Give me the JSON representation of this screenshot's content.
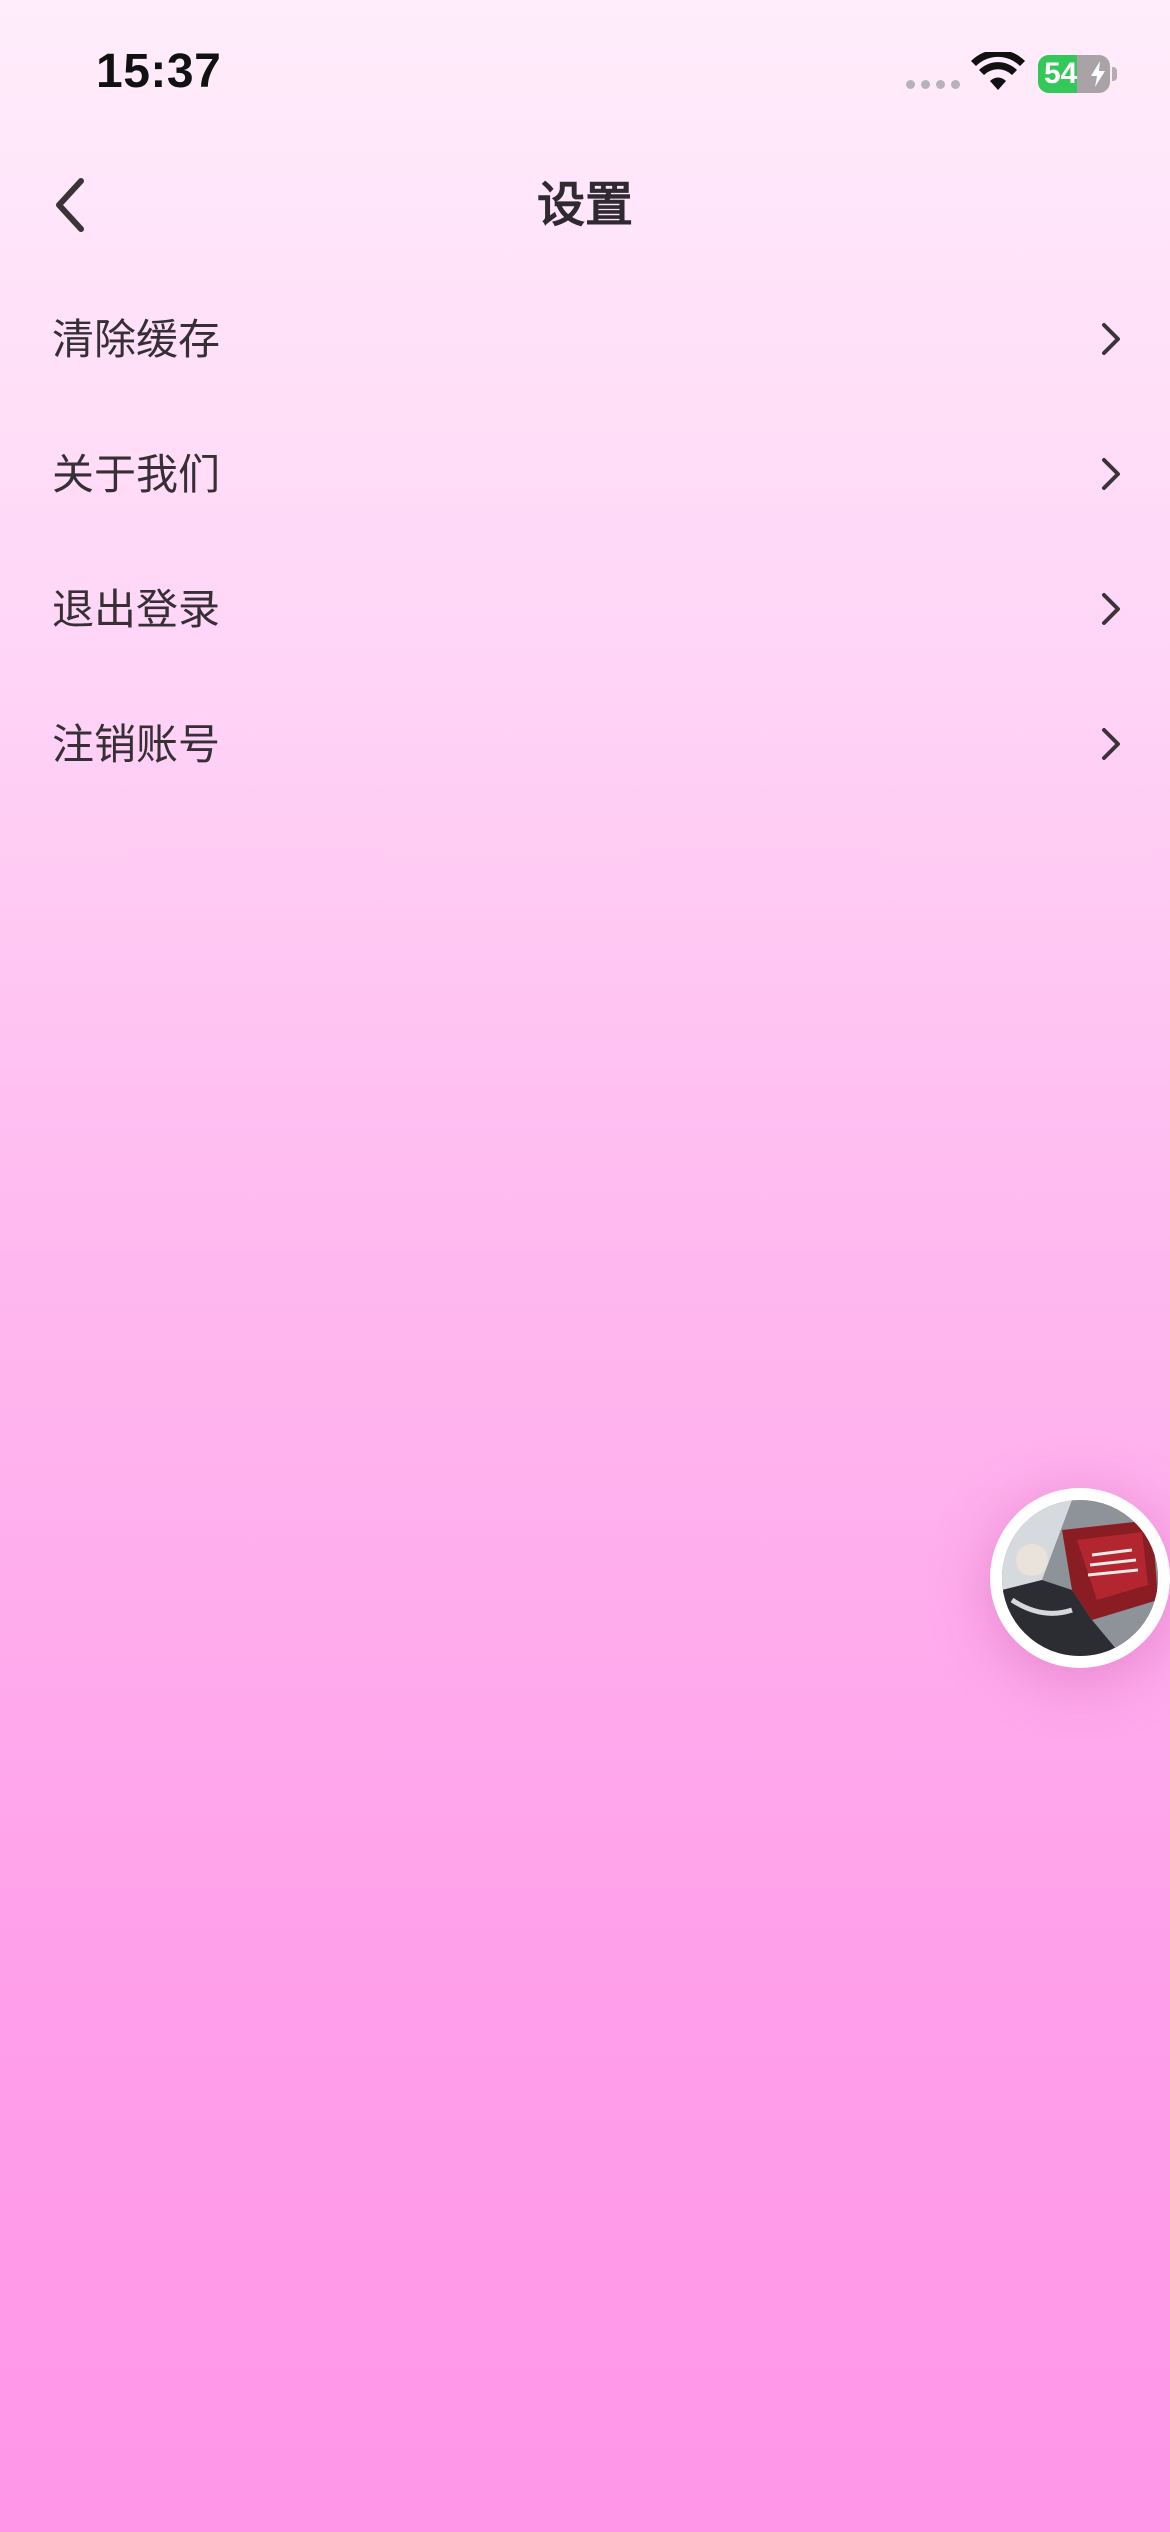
{
  "status_bar": {
    "time": "15:37",
    "battery_level": "54",
    "battery_fraction": 0.54,
    "icons": [
      "cellular-signal-icon",
      "wifi-icon",
      "battery-charging-icon"
    ]
  },
  "nav": {
    "title": "设置",
    "back_icon": "chevron-left-icon"
  },
  "menu": {
    "items": [
      {
        "label": "清除缓存",
        "icon": "chevron-right-icon"
      },
      {
        "label": "关于我们",
        "icon": "chevron-right-icon"
      },
      {
        "label": "退出登录",
        "icon": "chevron-right-icon"
      },
      {
        "label": "注销账号",
        "icon": "chevron-right-icon"
      }
    ]
  },
  "floating_avatar": {
    "icon": "avatar-image"
  },
  "colors": {
    "background_top": "#ffedfb",
    "background_bottom": "#ff96e8",
    "text_primary": "#363036",
    "battery_green": "#34c759"
  }
}
